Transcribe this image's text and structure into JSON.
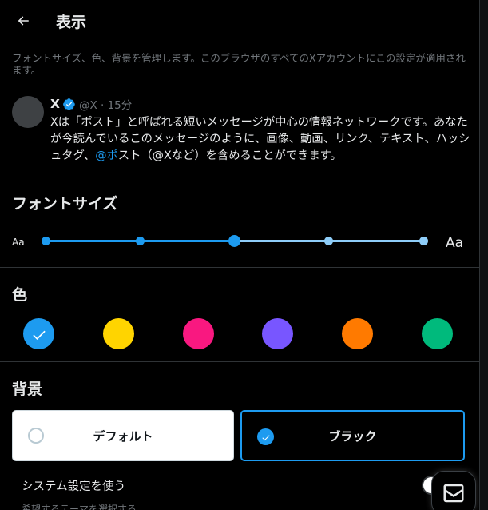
{
  "header": {
    "title": "表示",
    "back_icon": "arrow-left-icon"
  },
  "description": "フォントサイズ、色、背景を管理します。このブラウザのすべてのXアカウントにこの設定が適用されます。",
  "preview_tweet": {
    "name": "X",
    "handle_time": "@X · 15分",
    "body_before": "Xは「ポスト」と呼ばれる短いメッセージが中心の情報ネットワークです。あなたが今読んでいるこのメッセージのように、画像、動画、リンク、テキスト、ハッシュタグ、",
    "mention": "@ポ",
    "body_after": "スト（@Xなど）を含めることができます。"
  },
  "font_size": {
    "title": "フォントサイズ",
    "small_label": "Aa",
    "large_label": "Aa",
    "steps": 5,
    "selected_step": 3
  },
  "color": {
    "title": "色",
    "selected_index": 0,
    "options": [
      {
        "name": "blue",
        "hex": "#1d9bf0"
      },
      {
        "name": "yellow",
        "hex": "#ffd400"
      },
      {
        "name": "pink",
        "hex": "#f91880"
      },
      {
        "name": "purple",
        "hex": "#7856ff"
      },
      {
        "name": "orange",
        "hex": "#ff7a00"
      },
      {
        "name": "green",
        "hex": "#00ba7c"
      }
    ]
  },
  "background": {
    "title": "背景",
    "options": [
      {
        "label": "デフォルト",
        "selected": false
      },
      {
        "label": "ブラック",
        "selected": true
      }
    ]
  },
  "system": {
    "label": "システム設定を使う",
    "sublabel": "希望するテーマを選択する",
    "enabled": false
  },
  "colors": {
    "accent": "#1d9bf0",
    "accent_light": "#8ecdf8",
    "background": "#000000",
    "text": "#e7e9ea",
    "muted": "#71767b",
    "border": "#2f3336"
  },
  "fab": {
    "icon": "mail-icon"
  }
}
